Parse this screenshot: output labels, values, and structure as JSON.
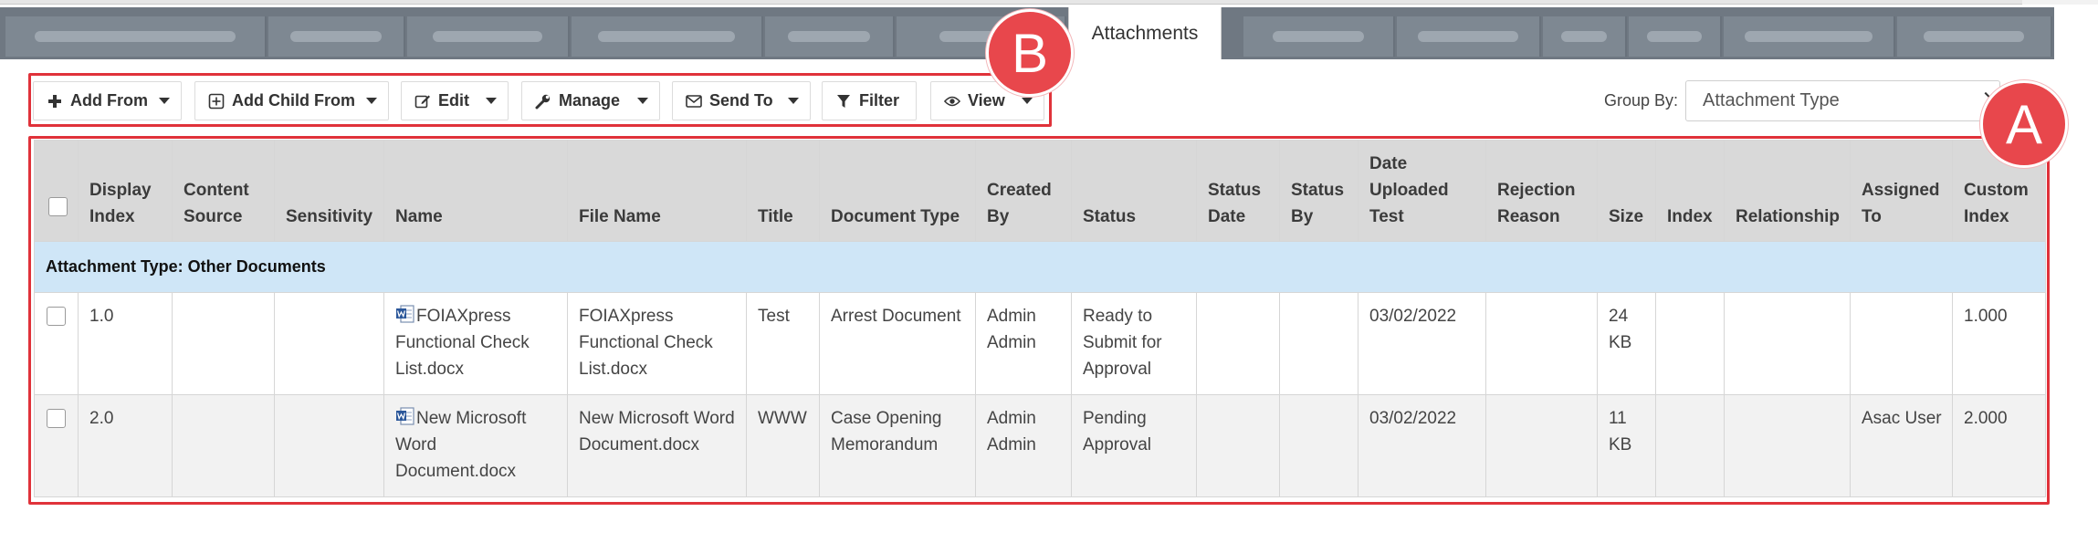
{
  "tabs": {
    "active_label": "Attachments"
  },
  "toolbar": {
    "add_from": "Add From",
    "add_child_from": "Add Child From",
    "edit": "Edit",
    "manage": "Manage",
    "send_to": "Send To",
    "filter": "Filter",
    "view": "View"
  },
  "group_by": {
    "label": "Group By:",
    "selected": "Attachment Type"
  },
  "annotations": {
    "a": "A",
    "b": "B"
  },
  "grid": {
    "columns": [
      "",
      "Display Index",
      "Content Source",
      "Sensitivity",
      "Name",
      "File Name",
      "Title",
      "Document Type",
      "Created By",
      "Status",
      "Status Date",
      "Status By",
      "Date Uploaded Test",
      "Rejection Reason",
      "Size",
      "Index",
      "Relationship",
      "Assigned To",
      "Custom Index"
    ],
    "group_label": "Attachment Type: Other Documents",
    "rows": [
      {
        "display_index": "1.0",
        "content_source": "",
        "sensitivity": "",
        "name": "FOIAXpress Functional Check List.docx",
        "file_name": "FOIAXpress Functional Check List.docx",
        "title": "Test",
        "document_type": "Arrest Document",
        "created_by": "Admin Admin",
        "status": "Ready to Submit for Approval",
        "status_date": "",
        "status_by": "",
        "date_uploaded": "03/02/2022",
        "rejection_reason": "",
        "size": "24 KB",
        "index": "",
        "relationship": "",
        "assigned_to": "",
        "custom_index": "1.000"
      },
      {
        "display_index": "2.0",
        "content_source": "",
        "sensitivity": "",
        "name": "New Microsoft Word Document.docx",
        "file_name": "New Microsoft Word Document.docx",
        "title": "WWW",
        "document_type": "Case Opening Memorandum",
        "created_by": "Admin Admin",
        "status": "Pending Approval",
        "status_date": "",
        "status_by": "",
        "date_uploaded": "03/02/2022",
        "rejection_reason": "",
        "size": "11 KB",
        "index": "",
        "relationship": "",
        "assigned_to": "Asac User",
        "custom_index": "2.000"
      }
    ]
  },
  "colors": {
    "highlight_red": "#e0323a",
    "group_row_bg": "#cfe6f7",
    "header_bg": "#d9d9d9",
    "tabstrip_bg": "#6f7882"
  }
}
